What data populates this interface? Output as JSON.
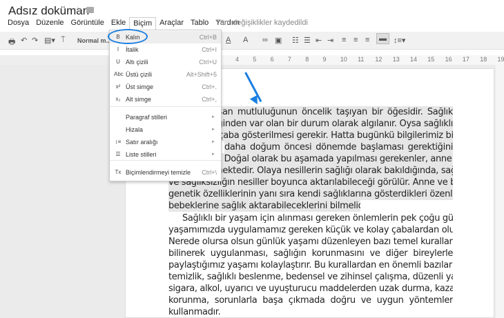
{
  "title": "Adsız doküman",
  "menubar": [
    "Dosya",
    "Düzenle",
    "Görüntüle",
    "Ekle",
    "Biçim",
    "Araçlar",
    "Tablo",
    "Yardım"
  ],
  "saved_status": "Tüm değişiklikler kaydedildi",
  "toolbar": {
    "style": "Normal m...",
    "text_color": "A",
    "highlight": "A"
  },
  "ruler": [
    "4",
    "5",
    "6",
    "7",
    "8",
    "9",
    "10",
    "11",
    "12",
    "13",
    "14",
    "15",
    "16",
    "17",
    "18",
    "19"
  ],
  "format_menu": {
    "items": [
      {
        "icon": "B",
        "label": "Kalın",
        "shortcut": "Ctrl+B"
      },
      {
        "icon": "I",
        "label": "İtalik",
        "shortcut": "Ctrl+I"
      },
      {
        "icon": "U",
        "label": "Altı çizili",
        "shortcut": "Ctrl+U"
      },
      {
        "icon": "Abc",
        "label": "Üstü çizili",
        "shortcut": "Alt+Shift+5"
      },
      {
        "icon": "x²",
        "label": "Üst simge",
        "shortcut": "Ctrl+."
      },
      {
        "icon": "x₂",
        "label": "Alt simge",
        "shortcut": "Ctrl+,"
      },
      {
        "label": "Paragraf stilleri"
      },
      {
        "label": "Hizala"
      },
      {
        "icon": "↕≡",
        "label": "Satır aralığı"
      },
      {
        "icon": "☰",
        "label": "Liste stilleri"
      },
      {
        "icon": "Tx",
        "label": "Biçimlendirmeyi temizle",
        "shortcut": "Ctrl+\\"
      }
    ]
  },
  "accent": "#1a7ee0",
  "document": {
    "para1": [
      "k, insan mutluluğunun öncelik taşıyan bir öğesidir. Sağlık",
      "diliğinden var olan bir durum olarak algılanır. Oysa sağlıklı",
      "a çaba gösterilmesi gerekir. Hatta bugünkü bilgilerimiz bize",
      "daha doğum öncesi dönemde başlaması gerektiğini",
      "ir. Doğal olarak bu aşamada yapılması gerekenler, anne ve",
      "mektedir. Olaya nesillerin sağlığı olarak bakıldığında, sağlığın",
      "ve sağlıksızlığın nesiller boyunca aktarılabileceği görülür. Anne ve babalar",
      "genetik özelliklerinin yanı sıra kendi sağlıklarına gösterdikleri özenle",
      "bebeklerine sağlık aktarabileceklerini bilmelidirler."
    ],
    "para2": [
      "Sağlıklı bir yaşam için alınması gereken önlemlerin pek çoğu günlük",
      "yaşamımızda  uygulamamız gereken küçük ve kolay çabalardan oluşur.",
      "Nerede olursa olsun günlük yaşamı düzenleyen bazı temel kuralların",
      "bilinerek uygulanması, sağlığın korunmasını ve diğer bireylerle",
      "paylaştığımız yaşamı kolaylaştırır. Bu kurallardan en önemli bazıları",
      "temizlik, sağlıklı beslenme, bedensel ve zihinsel çalışma, düzenli yaşam,",
      "sigara, alkol, uyarıcı ve uyuşturucu maddelerden uzak durma, kazalardan",
      "korunma, sorunlarla başa çıkmada doğru ve uygun yöntemler",
      "kullanmadır."
    ]
  }
}
